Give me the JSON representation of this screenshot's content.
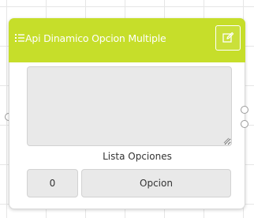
{
  "node": {
    "title": "Api Dinamico Opcion Multiple",
    "header_icon": "list-icon",
    "edit_icon": "edit-icon",
    "header_color": "#c6de2a",
    "options_textarea": {
      "value": ""
    },
    "list_label": "Lista Opciones",
    "option_row": {
      "index": "0",
      "option": "Opcion"
    }
  }
}
